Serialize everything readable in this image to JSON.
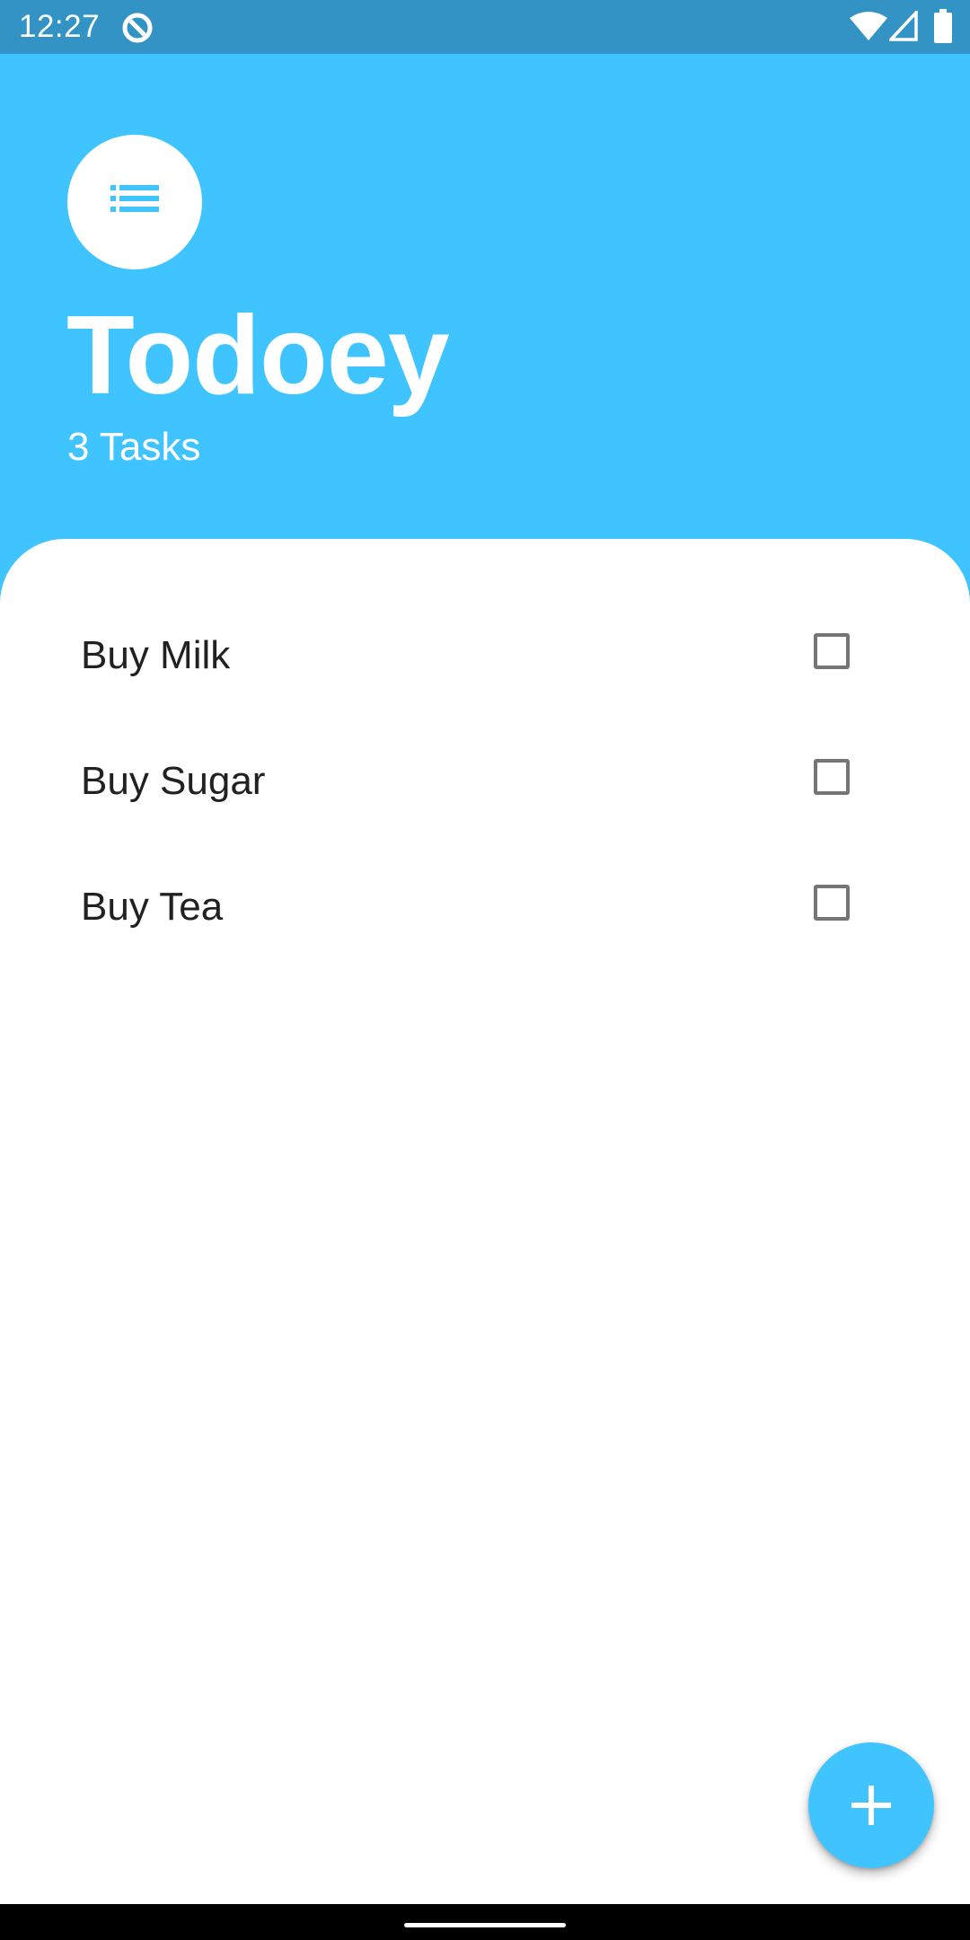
{
  "status_bar": {
    "time": "12:27",
    "icons": [
      "app-notification-icon",
      "wifi-icon",
      "cell-signal-icon",
      "battery-icon"
    ]
  },
  "header": {
    "icon": "list-icon",
    "title": "Todoey",
    "task_count": "3 Tasks"
  },
  "tasks": [
    {
      "label": "Buy Milk",
      "checked": false
    },
    {
      "label": "Buy Sugar",
      "checked": false
    },
    {
      "label": "Buy Tea",
      "checked": false
    }
  ],
  "fab": {
    "icon": "add-icon"
  },
  "colors": {
    "accent": "#40c4ff",
    "status_bar": "#3393c4",
    "sheet": "#ffffff",
    "text": "#212121",
    "checkbox_border": "#757575"
  }
}
